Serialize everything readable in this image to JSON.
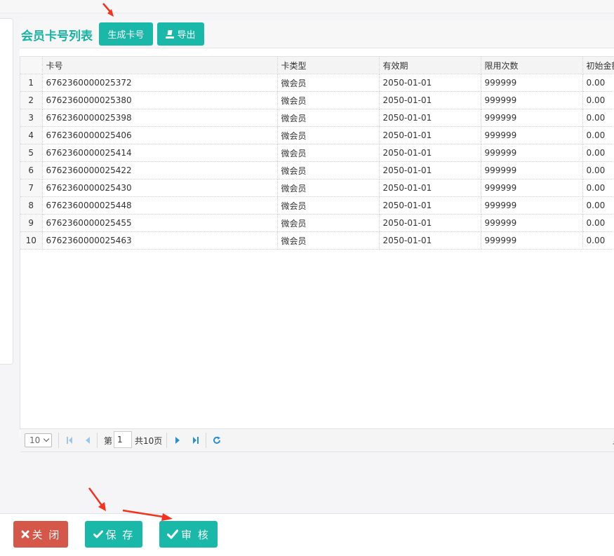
{
  "panel": {
    "title": "会员卡号列表",
    "generate_button": "生成卡号",
    "export_button": "导出"
  },
  "grid": {
    "columns": [
      "卡号",
      "卡类型",
      "有效期",
      "限用次数",
      "初始金额"
    ],
    "rows": [
      [
        "1",
        "6762360000025372",
        "微会员",
        "2050-01-01",
        "999999",
        "0.00"
      ],
      [
        "2",
        "6762360000025380",
        "微会员",
        "2050-01-01",
        "999999",
        "0.00"
      ],
      [
        "3",
        "6762360000025398",
        "微会员",
        "2050-01-01",
        "999999",
        "0.00"
      ],
      [
        "4",
        "6762360000025406",
        "微会员",
        "2050-01-01",
        "999999",
        "0.00"
      ],
      [
        "5",
        "6762360000025414",
        "微会员",
        "2050-01-01",
        "999999",
        "0.00"
      ],
      [
        "6",
        "6762360000025422",
        "微会员",
        "2050-01-01",
        "999999",
        "0.00"
      ],
      [
        "7",
        "6762360000025430",
        "微会员",
        "2050-01-01",
        "999999",
        "0.00"
      ],
      [
        "8",
        "6762360000025448",
        "微会员",
        "2050-01-01",
        "999999",
        "0.00"
      ],
      [
        "9",
        "6762360000025455",
        "微会员",
        "2050-01-01",
        "999999",
        "0.00"
      ],
      [
        "10",
        "6762360000025463",
        "微会员",
        "2050-01-01",
        "999999",
        "0.00"
      ]
    ]
  },
  "pager": {
    "page_size": "10",
    "page_prefix": "第",
    "page_number": "1",
    "total_pages": "共10页",
    "clipped_text": "显"
  },
  "footer": {
    "close_label": "关 闭",
    "save_label": "保 存",
    "review_label": "审 核"
  },
  "colors": {
    "accent": "#19b8a8",
    "danger": "#d4574a",
    "arrow": "#f5321e"
  },
  "icons": [
    "first-page-icon",
    "prev-page-icon",
    "next-page-icon",
    "last-page-icon",
    "refresh-icon",
    "close-x-icon",
    "check-icon",
    "export-icon"
  ]
}
